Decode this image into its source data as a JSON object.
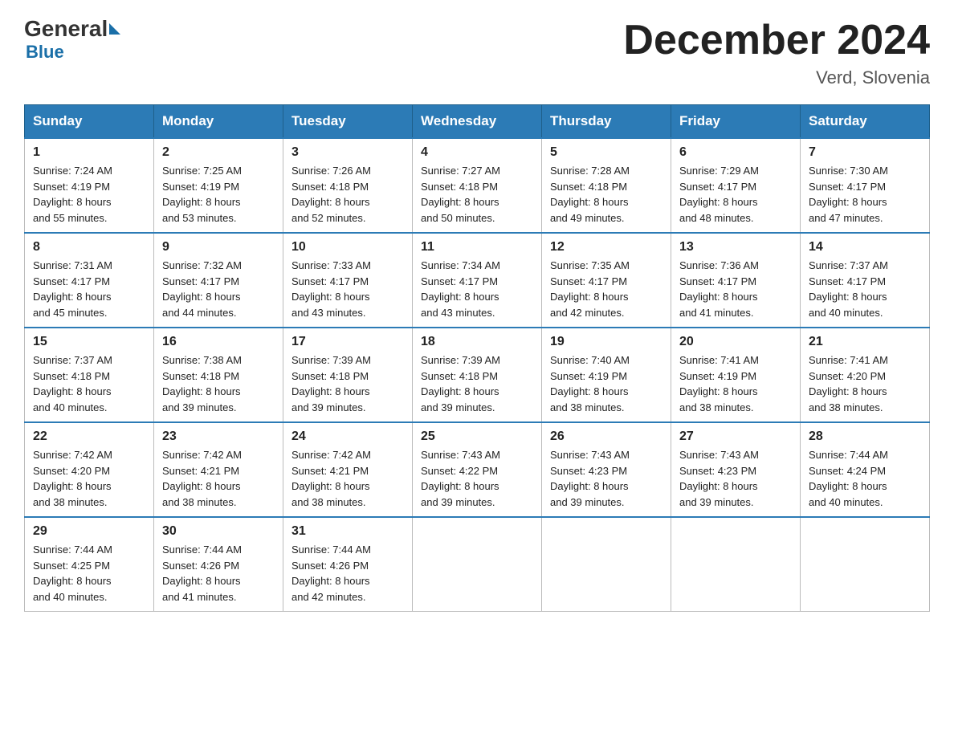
{
  "header": {
    "logo_general": "General",
    "logo_blue": "Blue",
    "month_title": "December 2024",
    "location": "Verd, Slovenia"
  },
  "weekdays": [
    "Sunday",
    "Monday",
    "Tuesday",
    "Wednesday",
    "Thursday",
    "Friday",
    "Saturday"
  ],
  "weeks": [
    [
      {
        "day": "1",
        "sunrise": "7:24 AM",
        "sunset": "4:19 PM",
        "daylight": "8 hours and 55 minutes."
      },
      {
        "day": "2",
        "sunrise": "7:25 AM",
        "sunset": "4:19 PM",
        "daylight": "8 hours and 53 minutes."
      },
      {
        "day": "3",
        "sunrise": "7:26 AM",
        "sunset": "4:18 PM",
        "daylight": "8 hours and 52 minutes."
      },
      {
        "day": "4",
        "sunrise": "7:27 AM",
        "sunset": "4:18 PM",
        "daylight": "8 hours and 50 minutes."
      },
      {
        "day": "5",
        "sunrise": "7:28 AM",
        "sunset": "4:18 PM",
        "daylight": "8 hours and 49 minutes."
      },
      {
        "day": "6",
        "sunrise": "7:29 AM",
        "sunset": "4:17 PM",
        "daylight": "8 hours and 48 minutes."
      },
      {
        "day": "7",
        "sunrise": "7:30 AM",
        "sunset": "4:17 PM",
        "daylight": "8 hours and 47 minutes."
      }
    ],
    [
      {
        "day": "8",
        "sunrise": "7:31 AM",
        "sunset": "4:17 PM",
        "daylight": "8 hours and 45 minutes."
      },
      {
        "day": "9",
        "sunrise": "7:32 AM",
        "sunset": "4:17 PM",
        "daylight": "8 hours and 44 minutes."
      },
      {
        "day": "10",
        "sunrise": "7:33 AM",
        "sunset": "4:17 PM",
        "daylight": "8 hours and 43 minutes."
      },
      {
        "day": "11",
        "sunrise": "7:34 AM",
        "sunset": "4:17 PM",
        "daylight": "8 hours and 43 minutes."
      },
      {
        "day": "12",
        "sunrise": "7:35 AM",
        "sunset": "4:17 PM",
        "daylight": "8 hours and 42 minutes."
      },
      {
        "day": "13",
        "sunrise": "7:36 AM",
        "sunset": "4:17 PM",
        "daylight": "8 hours and 41 minutes."
      },
      {
        "day": "14",
        "sunrise": "7:37 AM",
        "sunset": "4:17 PM",
        "daylight": "8 hours and 40 minutes."
      }
    ],
    [
      {
        "day": "15",
        "sunrise": "7:37 AM",
        "sunset": "4:18 PM",
        "daylight": "8 hours and 40 minutes."
      },
      {
        "day": "16",
        "sunrise": "7:38 AM",
        "sunset": "4:18 PM",
        "daylight": "8 hours and 39 minutes."
      },
      {
        "day": "17",
        "sunrise": "7:39 AM",
        "sunset": "4:18 PM",
        "daylight": "8 hours and 39 minutes."
      },
      {
        "day": "18",
        "sunrise": "7:39 AM",
        "sunset": "4:18 PM",
        "daylight": "8 hours and 39 minutes."
      },
      {
        "day": "19",
        "sunrise": "7:40 AM",
        "sunset": "4:19 PM",
        "daylight": "8 hours and 38 minutes."
      },
      {
        "day": "20",
        "sunrise": "7:41 AM",
        "sunset": "4:19 PM",
        "daylight": "8 hours and 38 minutes."
      },
      {
        "day": "21",
        "sunrise": "7:41 AM",
        "sunset": "4:20 PM",
        "daylight": "8 hours and 38 minutes."
      }
    ],
    [
      {
        "day": "22",
        "sunrise": "7:42 AM",
        "sunset": "4:20 PM",
        "daylight": "8 hours and 38 minutes."
      },
      {
        "day": "23",
        "sunrise": "7:42 AM",
        "sunset": "4:21 PM",
        "daylight": "8 hours and 38 minutes."
      },
      {
        "day": "24",
        "sunrise": "7:42 AM",
        "sunset": "4:21 PM",
        "daylight": "8 hours and 38 minutes."
      },
      {
        "day": "25",
        "sunrise": "7:43 AM",
        "sunset": "4:22 PM",
        "daylight": "8 hours and 39 minutes."
      },
      {
        "day": "26",
        "sunrise": "7:43 AM",
        "sunset": "4:23 PM",
        "daylight": "8 hours and 39 minutes."
      },
      {
        "day": "27",
        "sunrise": "7:43 AM",
        "sunset": "4:23 PM",
        "daylight": "8 hours and 39 minutes."
      },
      {
        "day": "28",
        "sunrise": "7:44 AM",
        "sunset": "4:24 PM",
        "daylight": "8 hours and 40 minutes."
      }
    ],
    [
      {
        "day": "29",
        "sunrise": "7:44 AM",
        "sunset": "4:25 PM",
        "daylight": "8 hours and 40 minutes."
      },
      {
        "day": "30",
        "sunrise": "7:44 AM",
        "sunset": "4:26 PM",
        "daylight": "8 hours and 41 minutes."
      },
      {
        "day": "31",
        "sunrise": "7:44 AM",
        "sunset": "4:26 PM",
        "daylight": "8 hours and 42 minutes."
      },
      null,
      null,
      null,
      null
    ]
  ],
  "labels": {
    "sunrise": "Sunrise:",
    "sunset": "Sunset:",
    "daylight": "Daylight:"
  }
}
